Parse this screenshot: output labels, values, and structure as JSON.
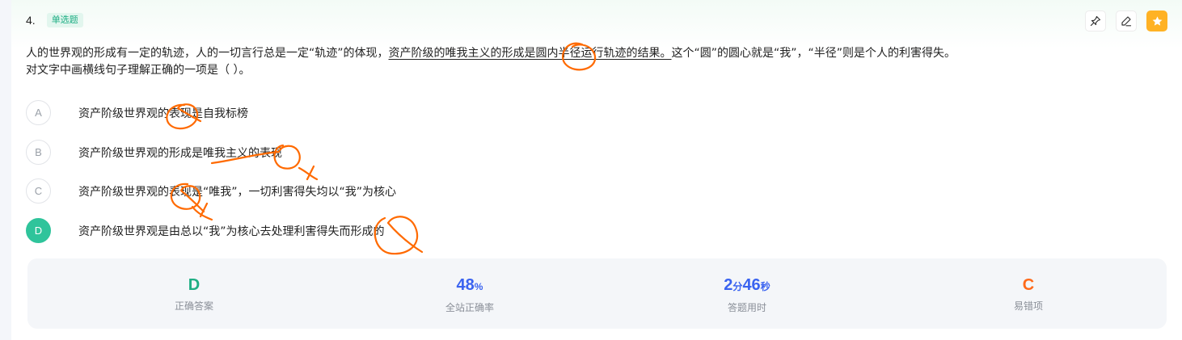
{
  "question": {
    "number": "4.",
    "type": "单选题",
    "stem_part1": "人的世界观的形成有一定的轨迹，人的一切言行总是一定“轨迹”的体现，",
    "stem_underlined": "资产阶级的唯我主义的形成是圆内半径运行轨迹的结果。",
    "stem_part2": "这个“圆”的圆心就是“我”，“半径”则是个人的利害得失。",
    "stem_line2": "对文字中画横线句子理解正确的一项是（ ）。"
  },
  "options": [
    {
      "letter": "A",
      "text": "资产阶级世界观的表现是自我标榜",
      "selected": false
    },
    {
      "letter": "B",
      "text": "资产阶级世界观的形成是唯我主义的表现",
      "selected": false
    },
    {
      "letter": "C",
      "text": "资产阶级世界观的表现是“唯我”，一切利害得失均以“我”为核心",
      "selected": false
    },
    {
      "letter": "D",
      "text": "资产阶级世界观是由总以“我”为核心去处理利害得失而形成的",
      "selected": true
    }
  ],
  "stats": {
    "correct_answer": {
      "value": "D",
      "label": "正确答案"
    },
    "accuracy": {
      "value": "48",
      "unit": "%",
      "label": "全站正确率"
    },
    "time": {
      "min": "2",
      "min_unit": "分",
      "sec": "46",
      "sec_unit": "秒",
      "label": "答题用时"
    },
    "common_wrong": {
      "value": "C",
      "label": "易错项"
    }
  },
  "actions": [
    {
      "icon": "pin-icon"
    },
    {
      "icon": "edit-icon"
    },
    {
      "icon": "star-icon"
    }
  ],
  "colors": {
    "accent_green": "#2fc49b",
    "blue": "#3a63f0",
    "orange": "#ff6a1a",
    "star_bg": "#ffb224",
    "ink": "#ff6a00"
  }
}
